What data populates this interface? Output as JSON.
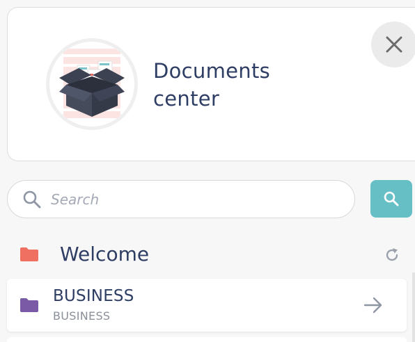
{
  "header": {
    "title_line1": "Documents",
    "title_line2": "center",
    "close_icon": "close-icon"
  },
  "search": {
    "placeholder": "Search",
    "value": "",
    "button_icon": "search-icon"
  },
  "welcome": {
    "label": "Welcome",
    "folder_color": "#ef6f61",
    "refresh_icon": "refresh-icon"
  },
  "folders": [
    {
      "title": "BUSINESS",
      "subtitle": "BUSINESS",
      "color": "#7a5aa6",
      "action_icon": "arrow-right-icon"
    }
  ],
  "colors": {
    "accent": "#67bfc6",
    "text": "#2e3d63",
    "muted": "#8a8f98"
  }
}
